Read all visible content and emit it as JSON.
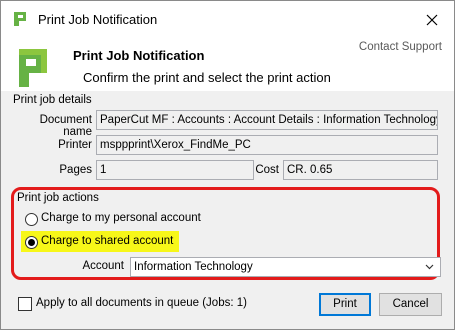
{
  "window": {
    "title": "Print Job Notification"
  },
  "header": {
    "title": "Print Job Notification",
    "subtitle": "Confirm the print and select the print action",
    "contact_link": "Contact Support"
  },
  "details": {
    "group_title": "Print job details",
    "document_label": "Document name",
    "document_value": "PaperCut MF : Accounts : Account Details : Information Technology",
    "printer_label": "Printer",
    "printer_value": "msppprint\\Xerox_FindMe_PC",
    "pages_label": "Pages",
    "pages_value": "1",
    "cost_label": "Cost",
    "cost_value": "CR. 0.65"
  },
  "actions": {
    "group_title": "Print job actions",
    "option_personal": "Charge to my personal account",
    "option_shared": "Charge to shared account",
    "selected": "shared",
    "account_label": "Account",
    "account_value": "Information Technology"
  },
  "footer": {
    "apply_all_label": "Apply to all documents in queue (Jobs: 1)",
    "apply_all_checked": false,
    "print_button": "Print",
    "cancel_button": "Cancel"
  },
  "colors": {
    "logo_green": "#66b245",
    "annotation_red": "#e31b1b",
    "highlight_yellow": "#f7f719",
    "focus_blue": "#0078d7"
  }
}
